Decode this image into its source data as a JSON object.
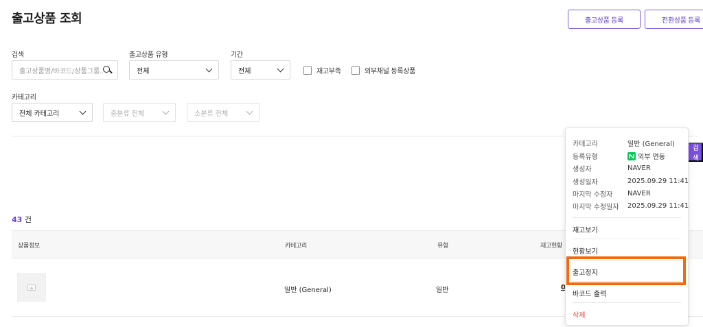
{
  "header": {
    "title": "출고상품 조회",
    "register_button": "출고상품 등록",
    "convert_button": "전환상품 등록"
  },
  "filters": {
    "search_label": "검색",
    "search_placeholder": "출고상품명/바코드/상품그룹...",
    "type_label": "출고상품 유형",
    "type_value": "전체",
    "period_label": "기간",
    "period_value": "전체",
    "out_of_stock_label": "재고부족",
    "external_channel_label": "외부채널 등록상품",
    "category_label": "카테고리",
    "category_value": "전체 카테고리",
    "mid_category_value": "중분류 전체",
    "sub_category_value": "소분류 전체",
    "search_button": "검색"
  },
  "results": {
    "count": "43",
    "count_unit": "건"
  },
  "table": {
    "headers": [
      "상품정보",
      "카테고리",
      "유형",
      "재고현황"
    ],
    "rows": [
      {
        "category": "일반 (General)",
        "type": "일반",
        "stock": "0"
      }
    ]
  },
  "popup": {
    "info": [
      {
        "key": "카테고리",
        "value": "일반 (General)"
      },
      {
        "key": "등록유형",
        "value": "외부 연동"
      },
      {
        "key": "생성자",
        "value": "NAVER"
      },
      {
        "key": "생성일자",
        "value": "2025.09.29 11:41"
      },
      {
        "key": "마지막 수정자",
        "value": "NAVER"
      },
      {
        "key": "마지막 수정일자",
        "value": "2025.09.29 11:41"
      }
    ],
    "menu": [
      "재고보기",
      "현황보기",
      "출고정지",
      "바코드 출력",
      "삭제"
    ]
  },
  "colors": {
    "accent": "#7a4fe0",
    "highlight": "#f26a10",
    "danger": "#e0463d",
    "naver": "#03c75a"
  }
}
